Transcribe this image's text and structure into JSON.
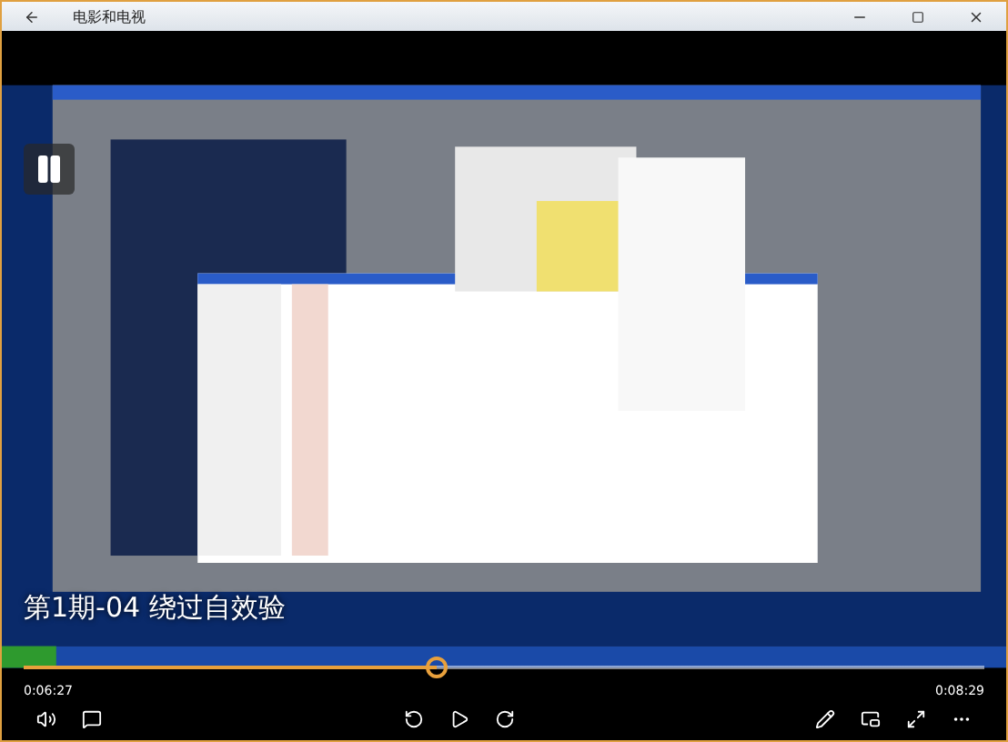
{
  "window": {
    "title": "电影和电视"
  },
  "player": {
    "video_title": "第1期-04 绕过自效验",
    "elapsed": "0:06:27",
    "duration": "0:08:29",
    "progress": {
      "level": 0.43
    }
  }
}
